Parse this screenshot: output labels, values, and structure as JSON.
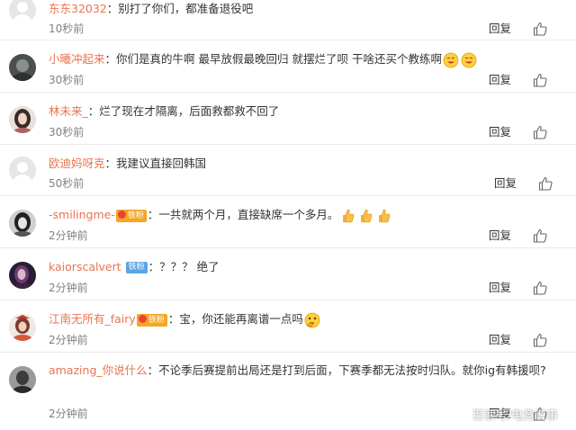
{
  "comments": [
    {
      "user": "东东32032",
      "sep": "：",
      "text": "别打了你们，都准备退役吧",
      "time": "10秒前",
      "reply": "回复"
    },
    {
      "user": "小曦冲起来",
      "sep": "：",
      "text": "你们是真的牛啊 最早放假最晚回归 就摆烂了呗 干啥还买个教练啊",
      "time": "30秒前",
      "reply": "回复"
    },
    {
      "user": "林未来_",
      "sep": "：",
      "text": "烂了现在才隔离，后面救都救不回了",
      "time": "30秒前",
      "reply": "回复"
    },
    {
      "user": "欧迪妈呀克",
      "sep": "：",
      "text": "我建议直接回韩国",
      "time": "50秒前",
      "reply": "回复"
    },
    {
      "user": "-smilingme-",
      "medal": "铁粉",
      "sep": "：",
      "text": "一共就两个月，直接缺席一个多月。",
      "time": "2分钟前",
      "reply": "回复"
    },
    {
      "user": "kaiorscalvert",
      "badge": "铁粉",
      "sep": "：",
      "text": "？？？ 绝了",
      "time": "2分钟前",
      "reply": "回复"
    },
    {
      "user": "江南无所有_fairy",
      "medal": "铁粉",
      "sep": "：",
      "text": "宝，你还能再离谱一点吗",
      "time": "2分钟前",
      "reply": "回复"
    },
    {
      "user": "amazing_你说什么",
      "sep": "：",
      "text": "不论季后赛提前出局还是打到后面，下赛季都无法按时归队。就你ig有韩援呗?",
      "time": "2分钟前",
      "reply": "回复"
    }
  ],
  "icons": {
    "like": "thumbs-up-icon",
    "emoji_smile": "smiling-emoji",
    "emoji_thumb": "thumbs-up-emoji",
    "emoji_think": "thinking-emoji"
  },
  "colors": {
    "username": "#eb7350",
    "badge": "#5ba4e5",
    "time": "#808080"
  },
  "watermark": "百家号/电竞说事"
}
